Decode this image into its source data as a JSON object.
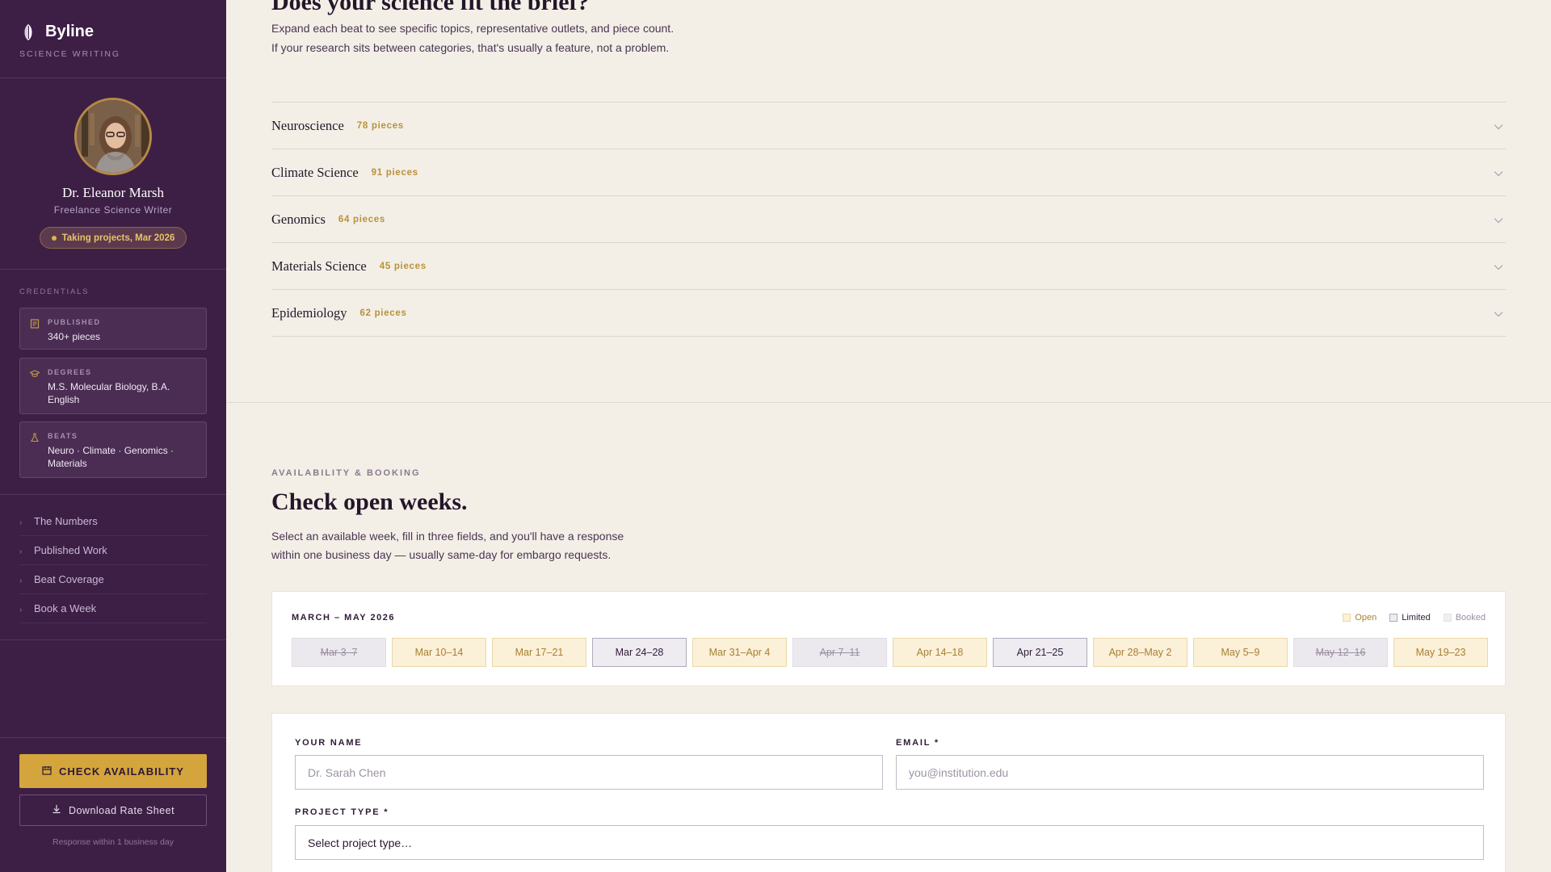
{
  "brand": {
    "name": "Byline",
    "subtitle": "SCIENCE WRITING"
  },
  "profile": {
    "name": "Dr. Eleanor Marsh",
    "role": "Freelance Science Writer",
    "status": "Taking projects, Mar 2026"
  },
  "credentials": {
    "label": "CREDENTIALS",
    "items": [
      {
        "title": "PUBLISHED",
        "value": "340+ pieces",
        "icon": "document-icon"
      },
      {
        "title": "DEGREES",
        "value": "M.S. Molecular Biology, B.A. English",
        "icon": "graduation-cap-icon"
      },
      {
        "title": "BEATS",
        "value": "Neuro · Climate · Genomics · Materials",
        "icon": "flask-icon"
      }
    ]
  },
  "nav": {
    "items": [
      {
        "label": "The Numbers"
      },
      {
        "label": "Published Work"
      },
      {
        "label": "Beat Coverage"
      },
      {
        "label": "Book a Week"
      }
    ]
  },
  "actions": {
    "check_availability": "CHECK AVAILABILITY",
    "download": "Download Rate Sheet",
    "response_note": "Response within 1 business day"
  },
  "beats_section": {
    "title": "Does your science fit the brief?",
    "intro": "Expand each beat to see specific topics, representative outlets, and piece count. If your research sits between categories, that's usually a feature, not a problem.",
    "beats": [
      {
        "name": "Neuroscience",
        "count": "78 pieces"
      },
      {
        "name": "Climate Science",
        "count": "91 pieces"
      },
      {
        "name": "Genomics",
        "count": "64 pieces"
      },
      {
        "name": "Materials Science",
        "count": "45 pieces"
      },
      {
        "name": "Epidemiology",
        "count": "62 pieces"
      }
    ]
  },
  "booking": {
    "eyebrow": "AVAILABILITY & BOOKING",
    "title": "Check open weeks.",
    "description": "Select an available week, fill in three fields, and you'll have a response within one business day — usually same-day for embargo requests.",
    "calendar": {
      "range": "MARCH – MAY 2026",
      "legend": {
        "open": "Open",
        "limited": "Limited",
        "booked": "Booked"
      },
      "weeks": [
        {
          "label": "Mar 3–7",
          "status": "booked"
        },
        {
          "label": "Mar 10–14",
          "status": "open"
        },
        {
          "label": "Mar 17–21",
          "status": "open"
        },
        {
          "label": "Mar 24–28",
          "status": "limited"
        },
        {
          "label": "Mar 31–Apr 4",
          "status": "open"
        },
        {
          "label": "Apr 7–11",
          "status": "booked"
        },
        {
          "label": "Apr 14–18",
          "status": "open"
        },
        {
          "label": "Apr 21–25",
          "status": "limited"
        },
        {
          "label": "Apr 28–May 2",
          "status": "open"
        },
        {
          "label": "May 5–9",
          "status": "open"
        },
        {
          "label": "May 12–16",
          "status": "booked"
        },
        {
          "label": "May 19–23",
          "status": "open"
        }
      ]
    },
    "form": {
      "name_label": "YOUR NAME",
      "name_placeholder": "Dr. Sarah Chen",
      "email_label": "EMAIL *",
      "email_placeholder": "you@institution.edu",
      "project_label": "PROJECT TYPE *",
      "project_value": "Select project type…"
    }
  },
  "colors": {
    "sidebar_bg": "#3d1f45",
    "accent_gold": "#d4a53d",
    "page_bg": "#f3efe7"
  }
}
